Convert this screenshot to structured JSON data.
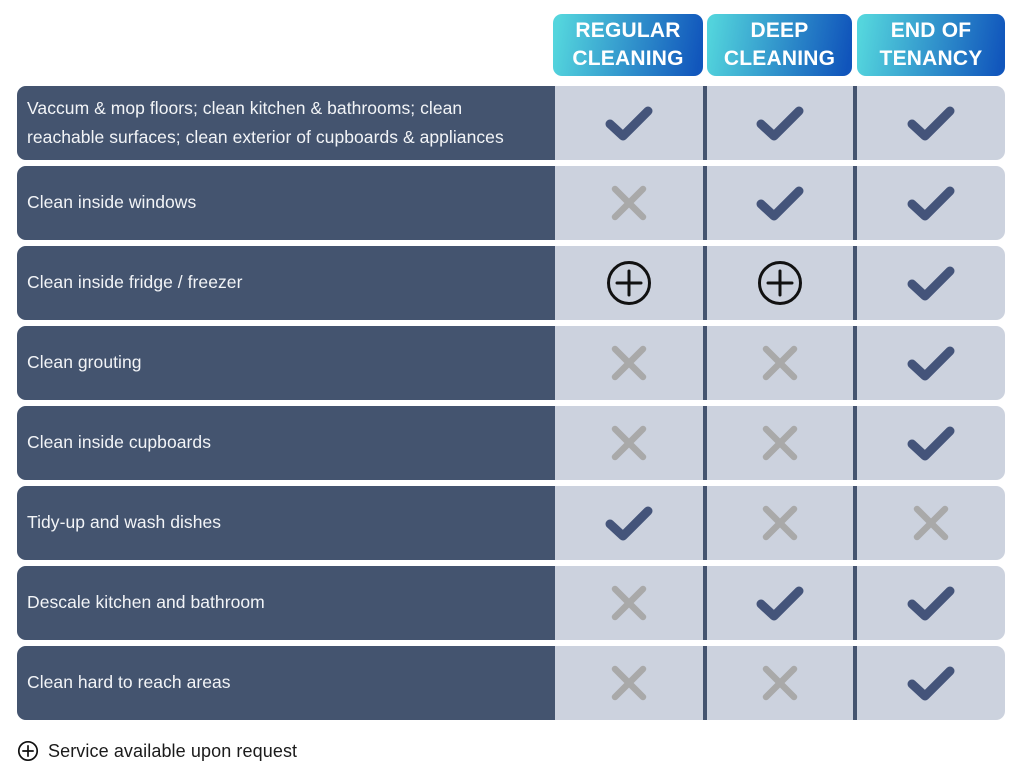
{
  "header": {
    "columns": [
      {
        "label": "REGULAR\nCLEANING",
        "gradient_from": "#54d5dd",
        "gradient_to": "#1156bc"
      },
      {
        "label": "DEEP\nCLEANING",
        "gradient_from": "#52d3dc",
        "gradient_to": "#1054bb"
      },
      {
        "label": "END OF\nTENANCY",
        "gradient_from": "#54d5dd",
        "gradient_to": "#1156bc"
      }
    ]
  },
  "colors": {
    "label_bar": "#44546f",
    "cell_background": "#ccd2de",
    "check": "#44547a",
    "cross": "#a9a9a9",
    "plus": "#111111",
    "page_background": "#ffffff"
  },
  "rows": [
    {
      "label": "Vaccum & mop floors; clean kitchen & bathrooms; clean\nreachable surfaces; clean exterior of cupboards & appliances",
      "height": 74,
      "values": [
        "check",
        "check",
        "check"
      ]
    },
    {
      "label": "Clean inside windows",
      "height": 74,
      "values": [
        "cross",
        "check",
        "check"
      ]
    },
    {
      "label": "Clean inside fridge / freezer",
      "height": 74,
      "values": [
        "plus",
        "plus",
        "check"
      ]
    },
    {
      "label": "Clean grouting",
      "height": 74,
      "values": [
        "cross",
        "cross",
        "check"
      ]
    },
    {
      "label": "Clean inside cupboards",
      "height": 74,
      "values": [
        "cross",
        "cross",
        "check"
      ]
    },
    {
      "label": "Tidy-up and wash dishes",
      "height": 74,
      "values": [
        "check",
        "cross",
        "cross"
      ]
    },
    {
      "label": "Descale kitchen and bathroom",
      "height": 74,
      "values": [
        "cross",
        "check",
        "check"
      ]
    },
    {
      "label": "Clean hard to reach areas",
      "height": 74,
      "values": [
        "cross",
        "cross",
        "check"
      ]
    }
  ],
  "footer": {
    "icon": "plus-circle-icon",
    "note": "Service available upon request"
  }
}
